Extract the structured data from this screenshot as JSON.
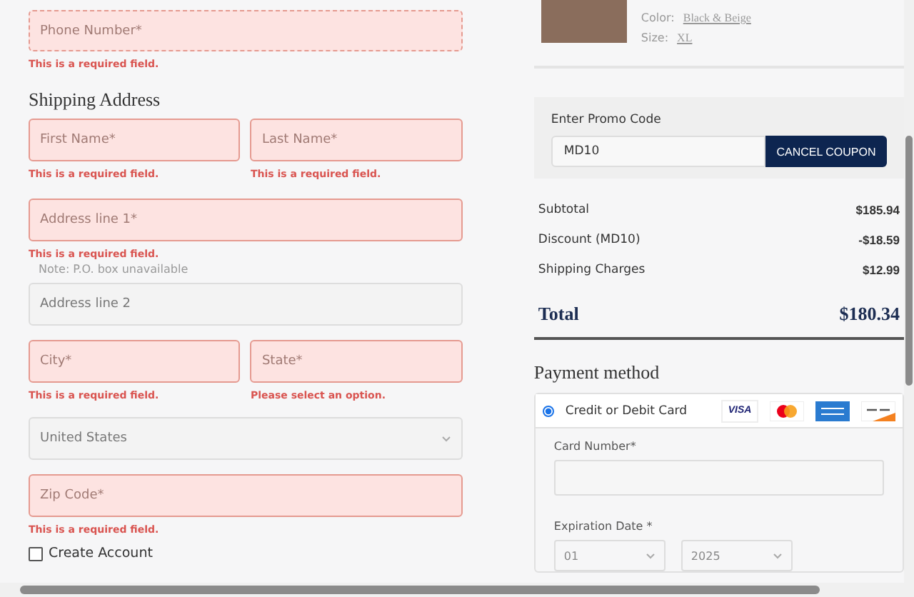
{
  "contact": {
    "phone": {
      "placeholder": "Phone Number*",
      "invalid": true,
      "focused": true,
      "error": "This is a required field."
    }
  },
  "shipping": {
    "title": "Shipping Address",
    "rows": [
      [
        {
          "kind": "text",
          "placeholder": "First Name*",
          "invalid": true,
          "error": "This is a required field."
        },
        {
          "kind": "text",
          "placeholder": "Last Name*",
          "invalid": true,
          "error": "This is a required field."
        }
      ],
      [
        {
          "kind": "text",
          "placeholder": "Address line 1*",
          "invalid": true,
          "error": "This is a required field.",
          "note": "Note: P.O. box unavailable"
        }
      ],
      [
        {
          "kind": "text",
          "placeholder": "Address line 2",
          "invalid": false
        }
      ],
      [
        {
          "kind": "text",
          "placeholder": "City*",
          "invalid": true,
          "error": "This is a required field."
        },
        {
          "kind": "select",
          "placeholder": "State*",
          "invalid": true,
          "error": "Please select an option."
        }
      ],
      [
        {
          "kind": "select",
          "value": "United States",
          "invalid": false
        }
      ],
      [
        {
          "kind": "text",
          "placeholder": "Zip Code*",
          "invalid": true,
          "error": "This is a required field."
        }
      ]
    ]
  },
  "create_account": {
    "label": "Create Account",
    "checked": false
  },
  "product": {
    "color_label": "Color:",
    "color_name": "Black & Beige",
    "size_label": "Size:",
    "size": "XL"
  },
  "promo": {
    "label": "Enter Promo Code",
    "value": "MD10",
    "button": "CANCEL COUPON"
  },
  "summary": {
    "rows": [
      {
        "label": "Subtotal",
        "amount": "$185.94"
      },
      {
        "label": "Discount (MD10)",
        "amount": "-$18.59"
      },
      {
        "label": "Shipping Charges",
        "amount": "$12.99"
      }
    ],
    "total": {
      "label": "Total",
      "amount": "$180.34"
    }
  },
  "payment": {
    "title": "Payment method",
    "methods": [
      {
        "label": "Credit or Debit Card",
        "selected": true,
        "logo_text": "VISA"
      }
    ],
    "card_number": {
      "label": "Card Number*"
    },
    "expiration": {
      "label": "Expiration Date *",
      "month": "01",
      "year": "2025"
    }
  }
}
